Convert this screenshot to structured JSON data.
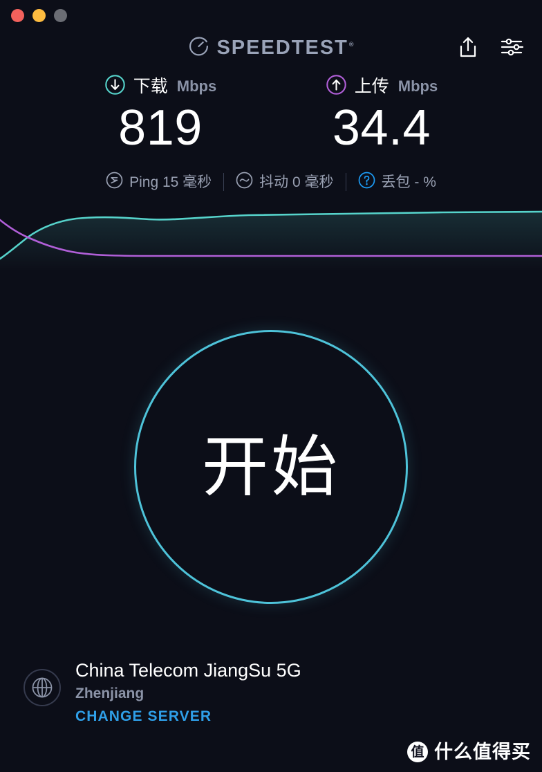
{
  "window": {
    "traffic_lights": [
      {
        "name": "close",
        "color": "#f2615c"
      },
      {
        "name": "minimize",
        "color": "#febc40"
      },
      {
        "name": "zoom",
        "color": "#6b6d74"
      }
    ]
  },
  "header": {
    "brand": "SPEEDTEST",
    "trademark": "®",
    "logo_icon": "speed-gauge-icon",
    "share_icon": "share-upload-icon",
    "settings_icon": "settings-sliders-icon"
  },
  "results": {
    "download": {
      "icon": "arrow-down-circle-icon",
      "label": "下载",
      "unit": "Mbps",
      "value": "819",
      "color": "#56d3cb"
    },
    "upload": {
      "icon": "arrow-up-circle-icon",
      "label": "上传",
      "unit": "Mbps",
      "value": "34.4",
      "color": "#b15fd8"
    }
  },
  "metrics": [
    {
      "icon": "ping-latency-icon",
      "name": "Ping",
      "value": "15",
      "unit": "毫秒",
      "icon_color": "#99a0b2"
    },
    {
      "icon": "jitter-wave-icon",
      "name": "抖动",
      "value": "0",
      "unit": "毫秒",
      "icon_color": "#99a0b2"
    },
    {
      "icon": "help-question-icon",
      "name": "丢包",
      "value": "-",
      "unit": "%",
      "icon_color": "#1c9cf6"
    }
  ],
  "chart_data": {
    "type": "line",
    "title": "",
    "xlabel": "",
    "ylabel": "",
    "grid": false,
    "legend": "none",
    "x": [
      0,
      5,
      10,
      15,
      20,
      25,
      30,
      35,
      40,
      50,
      60,
      70,
      80,
      90,
      100
    ],
    "series": [
      {
        "name": "下载",
        "color": "#56d3cb",
        "values": [
          8,
          14,
          22,
          34,
          46,
          58,
          66,
          72,
          76,
          79,
          80,
          81,
          82,
          83,
          83
        ]
      },
      {
        "name": "上传",
        "color": "#b15fd8",
        "values": [
          84,
          70,
          56,
          44,
          36,
          30,
          25,
          22,
          20,
          19,
          19,
          19,
          19,
          19,
          19
        ]
      }
    ],
    "ylim": [
      0,
      100
    ]
  },
  "go_button": {
    "label": "开始",
    "border_color": "#4ec3d9"
  },
  "server": {
    "icon": "globe-icon",
    "name": "China Telecom JiangSu 5G",
    "city": "Zhenjiang",
    "change_label": "CHANGE SERVER",
    "change_color": "#2f9fe8"
  },
  "watermark": {
    "badge": "值",
    "text": "什么值得买"
  }
}
